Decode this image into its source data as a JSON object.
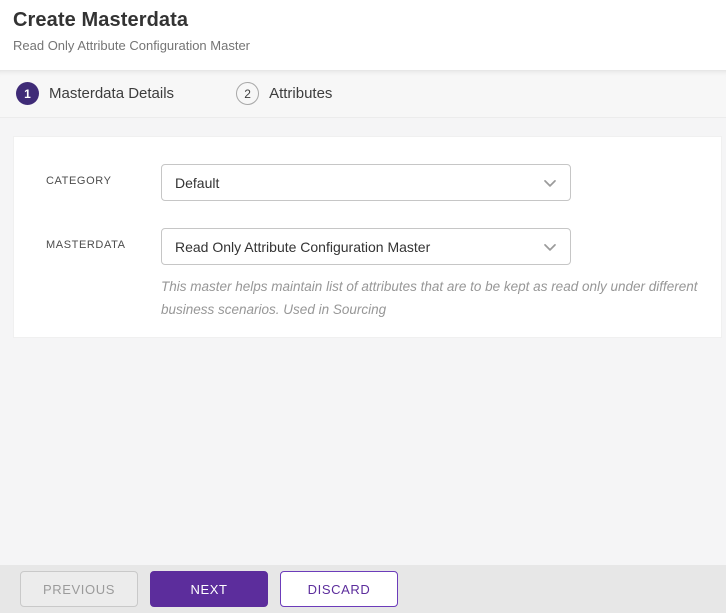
{
  "header": {
    "title": "Create Masterdata",
    "subtitle": "Read Only Attribute Configuration Master"
  },
  "steps": [
    {
      "number": "1",
      "label": "Masterdata Details",
      "state": "active"
    },
    {
      "number": "2",
      "label": "Attributes",
      "state": "inactive"
    }
  ],
  "form": {
    "fields": [
      {
        "label": "CATEGORY",
        "value": "Default"
      },
      {
        "label": "MASTERDATA",
        "value": "Read Only Attribute Configuration Master",
        "help": "This master helps maintain list of attributes that are to be kept as read only under different business scenarios. Used in Sourcing"
      }
    ]
  },
  "footer": {
    "previous_label": "PREVIOUS",
    "next_label": "NEXT",
    "discard_label": "DISCARD"
  },
  "icons": {
    "dropdown": "chevron-down-icon"
  },
  "colors": {
    "step_active": "#3f2b77",
    "primary_button": "#5c2d9c",
    "discard_border": "#6c3cba",
    "stepper_bg": "#f7f7f7",
    "footer_bg": "#e7e7e7",
    "page_bg": "#f5f5f6"
  }
}
